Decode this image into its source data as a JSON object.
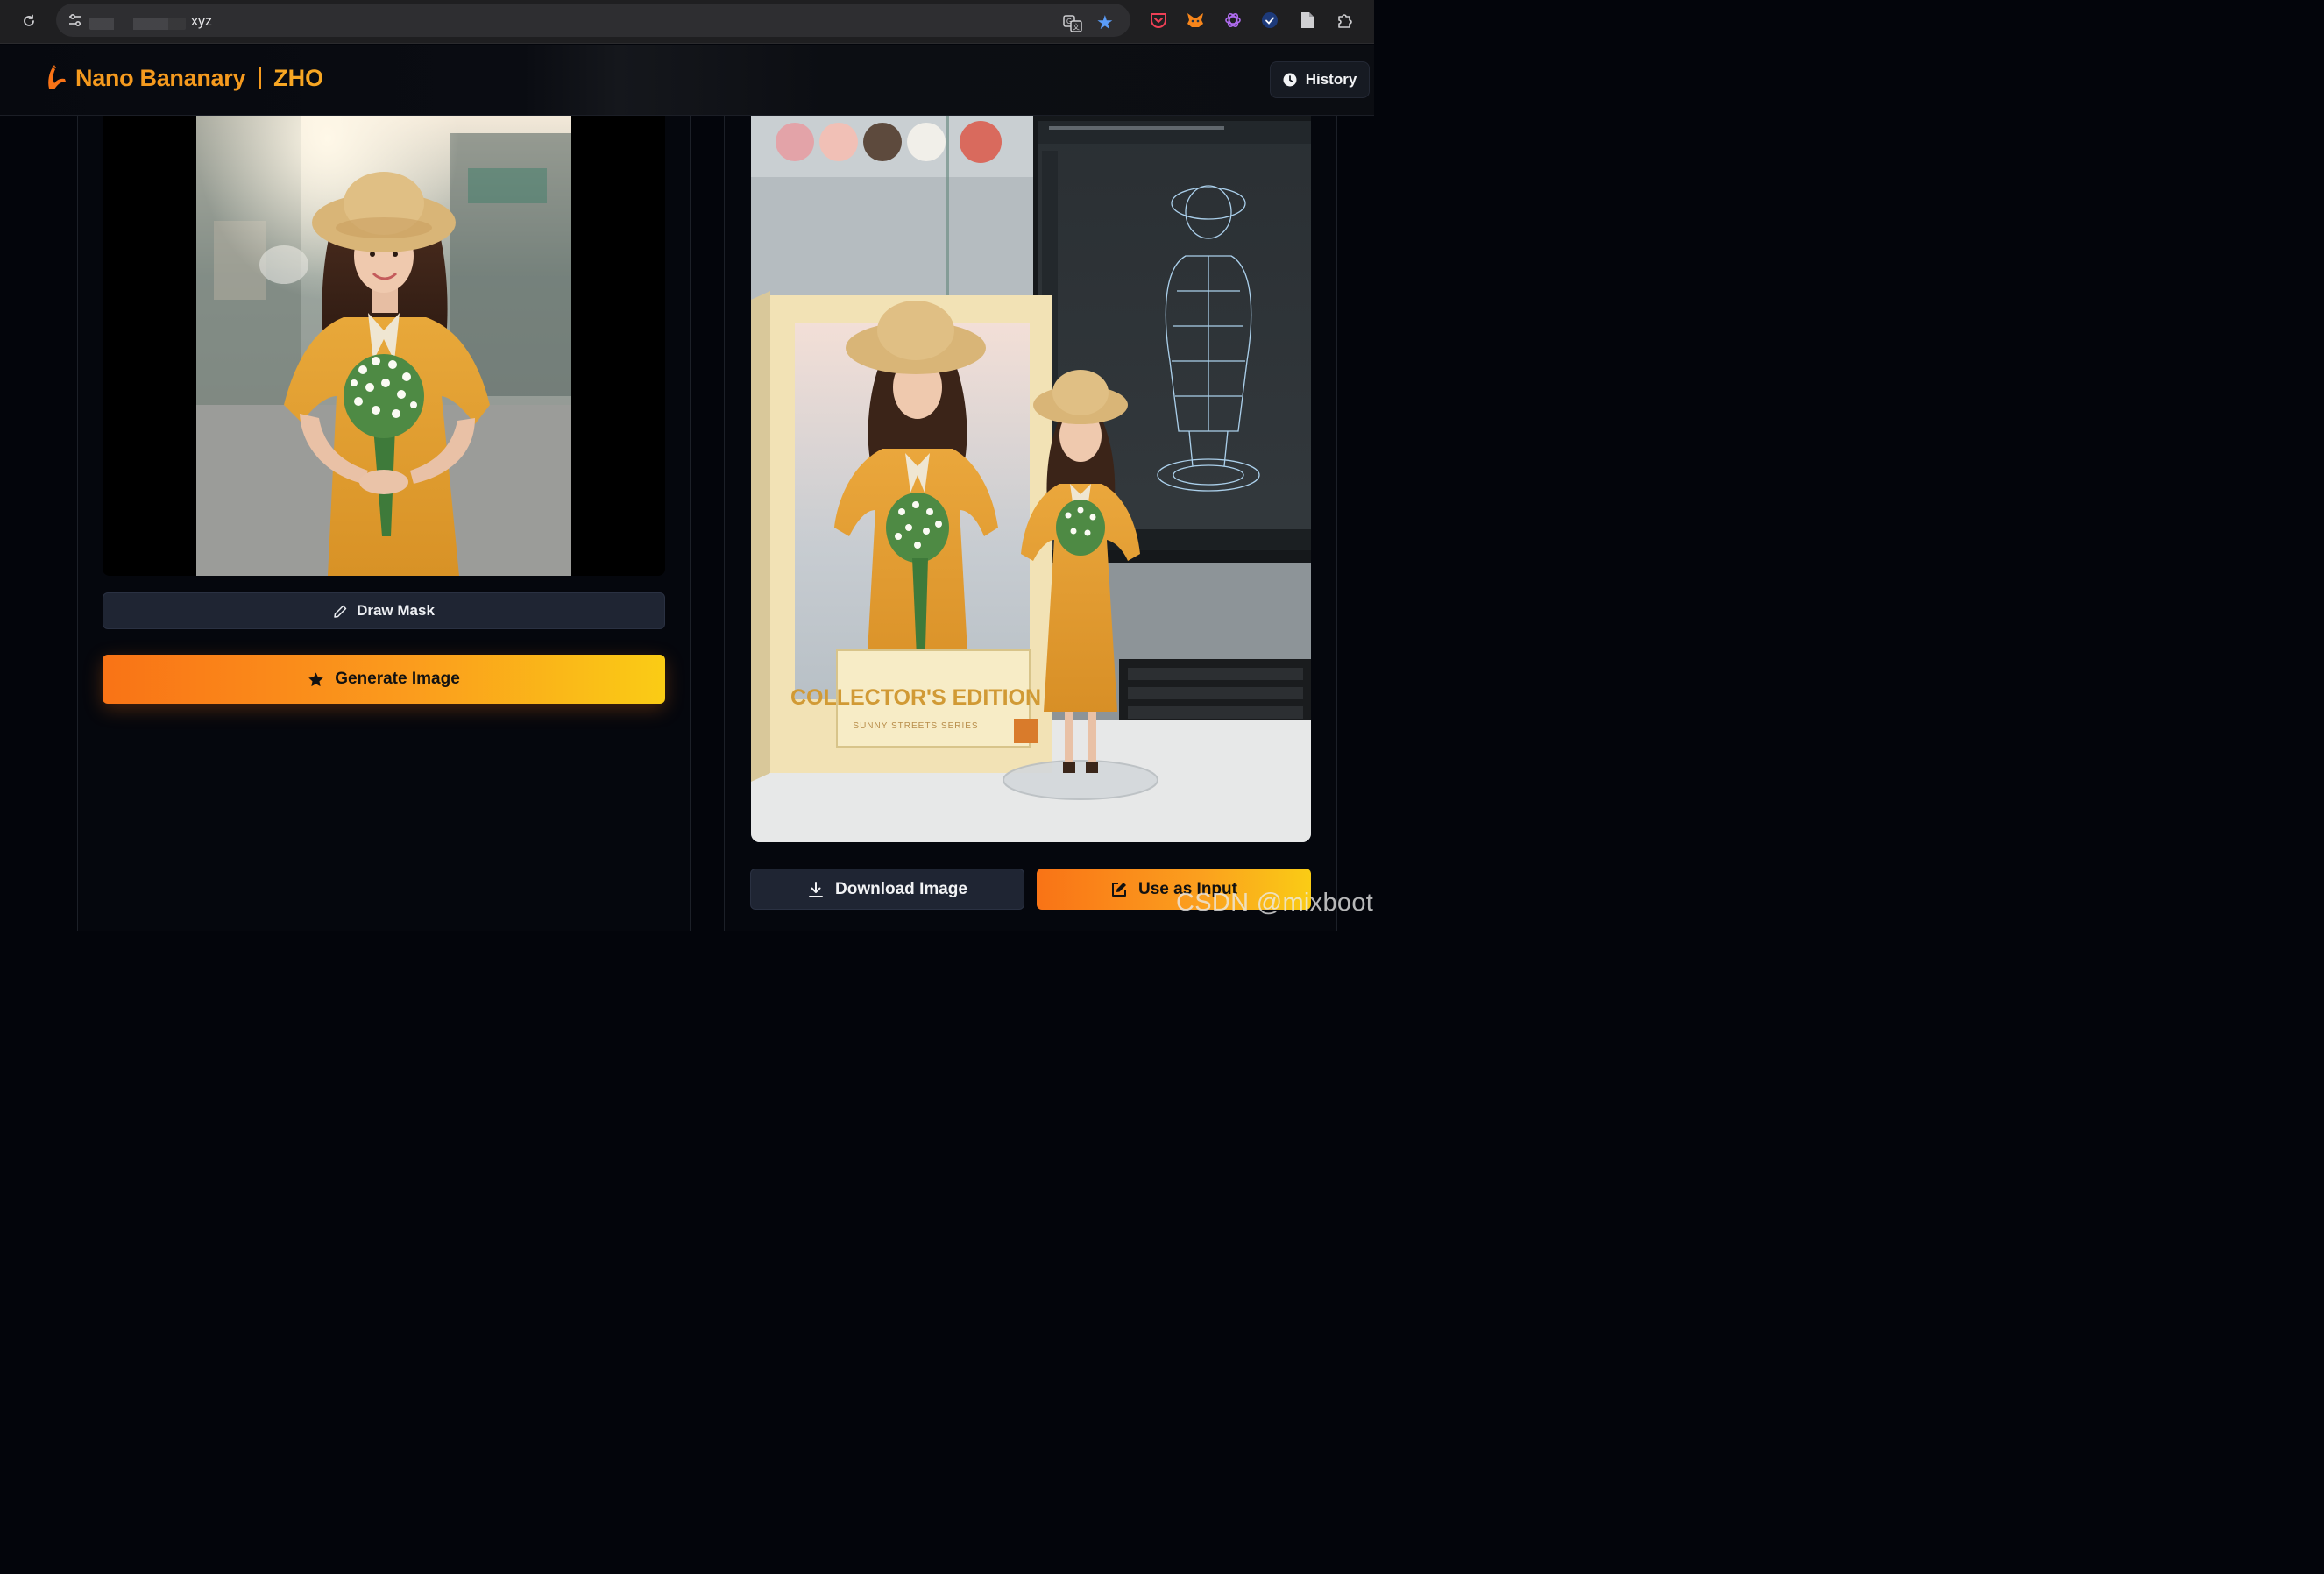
{
  "browser": {
    "url_suffix": "xyz",
    "icons": [
      "reload-icon",
      "site-settings-icon",
      "translate-icon",
      "bookmark-star-icon",
      "pocket-icon",
      "metamask-icon",
      "openai-icon",
      "todo-check-icon",
      "document-icon",
      "extensions-icon"
    ]
  },
  "header": {
    "brand": "Nano Bananary",
    "brand_sub": "ZHO",
    "history_label": "History"
  },
  "left_panel": {
    "draw_mask_label": "Draw Mask",
    "generate_label": "Generate Image"
  },
  "right_panel": {
    "box_title": "COLLECTOR'S EDITION",
    "box_series": "SUNNY STREETS SERIES",
    "download_label": "Download Image",
    "use_as_input_label": "Use as Input"
  },
  "watermark": "CSDN @mixboot",
  "colors": {
    "accent_orange": "#f97316",
    "accent_yellow": "#facc15",
    "brand": "#f59a1e",
    "button_dark": "#1f2533",
    "page_bg": "#03050b"
  }
}
